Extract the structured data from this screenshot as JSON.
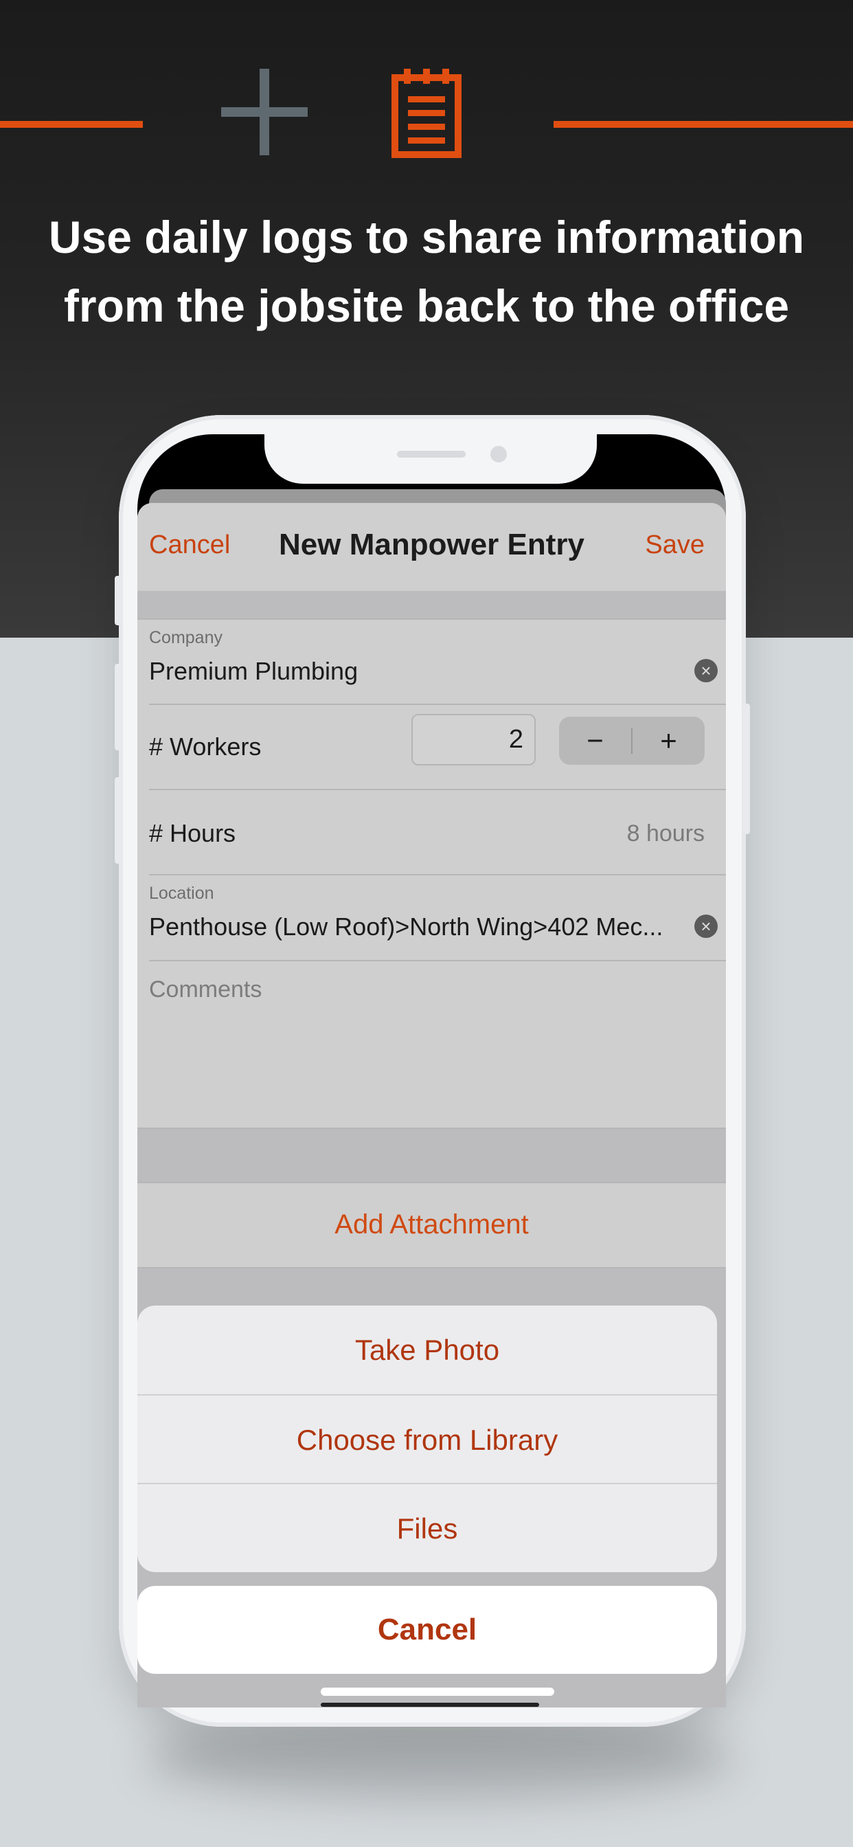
{
  "promo": {
    "headline_line1": "Use daily logs to share information",
    "headline_line2": "from the jobsite back to the office",
    "accent_color": "#e14e11",
    "icons": [
      "plus-icon",
      "daily-log-notepad-icon"
    ]
  },
  "nav": {
    "cancel_label": "Cancel",
    "title": "New Manpower Entry",
    "save_label": "Save"
  },
  "form": {
    "company_label": "Company",
    "company_value": "Premium Plumbing",
    "workers_label": "# Workers",
    "workers_value": "2",
    "stepper_minus": "−",
    "stepper_plus": "+",
    "hours_label": "# Hours",
    "hours_value": "8 hours",
    "location_label": "Location",
    "location_value": "Penthouse (Low Roof)>North Wing>402 Mec...",
    "comments_placeholder": "Comments"
  },
  "attachment": {
    "add_label": "Add Attachment"
  },
  "action_sheet": {
    "items": [
      "Take Photo",
      "Choose from Library",
      "Files"
    ],
    "cancel_label": "Cancel"
  }
}
